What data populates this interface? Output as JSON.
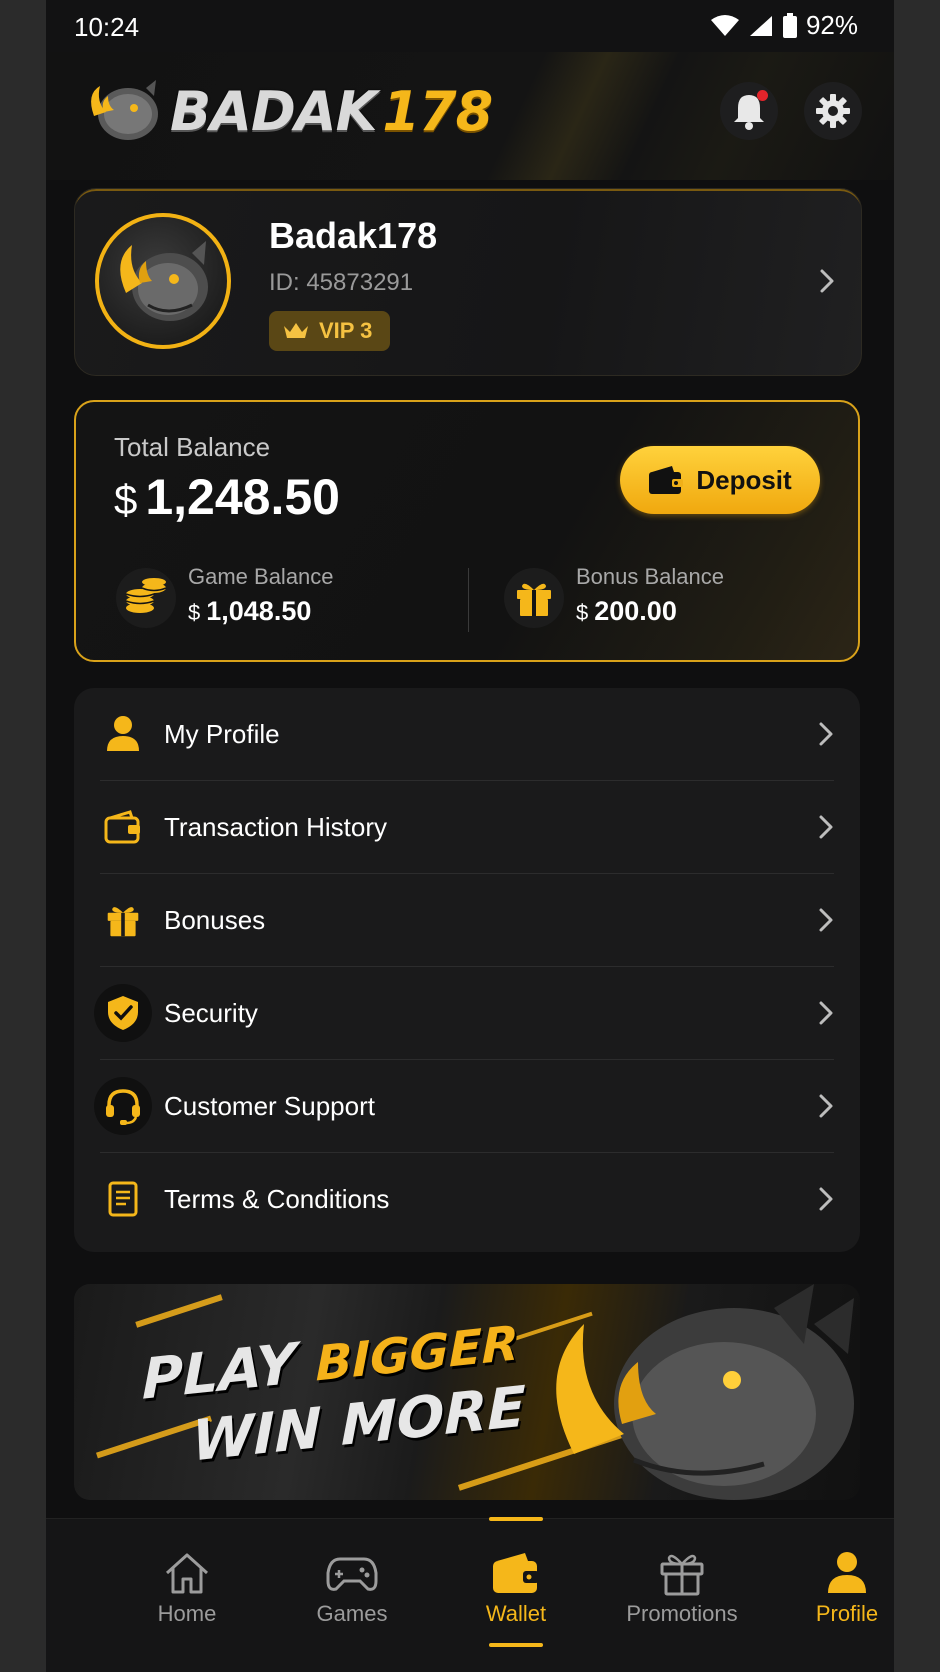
{
  "status_bar": {
    "time": "10:24",
    "battery": "92%"
  },
  "header": {
    "logo_part1": "BADAK",
    "logo_part2": "178"
  },
  "profile": {
    "name": "Badak178",
    "id_text": "ID: 45873291",
    "vip_label": "VIP 3"
  },
  "balance": {
    "total_label": "Total Balance",
    "currency": "$",
    "total_value": "1,248.50",
    "deposit_label": "Deposit",
    "game_label": "Game Balance",
    "game_value": "1,048.50",
    "bonus_label": "Bonus Balance",
    "bonus_value": "200.00"
  },
  "menu": {
    "items": [
      {
        "label": "My Profile",
        "icon": "user-icon"
      },
      {
        "label": "Transaction History",
        "icon": "wallet-icon"
      },
      {
        "label": "Bonuses",
        "icon": "gift-icon"
      },
      {
        "label": "Security",
        "icon": "shield-check-icon"
      },
      {
        "label": "Customer Support",
        "icon": "headset-icon"
      },
      {
        "label": "Terms & Conditions",
        "icon": "document-icon"
      }
    ]
  },
  "banner": {
    "word_play": "PLAY",
    "word_bigger": "BIGGER",
    "line2": "WIN MORE"
  },
  "bottom_nav": {
    "items": [
      {
        "label": "Home",
        "icon": "home-icon"
      },
      {
        "label": "Games",
        "icon": "gamepad-icon"
      },
      {
        "label": "Wallet",
        "icon": "wallet-icon"
      },
      {
        "label": "Promotions",
        "icon": "gift-icon"
      },
      {
        "label": "Profile",
        "icon": "user-icon"
      }
    ],
    "active": "Wallet"
  },
  "colors": {
    "accent": "#f5b71a",
    "background": "#0f0f10",
    "card": "#1a1a1b",
    "notification_dot": "#e3242b"
  }
}
